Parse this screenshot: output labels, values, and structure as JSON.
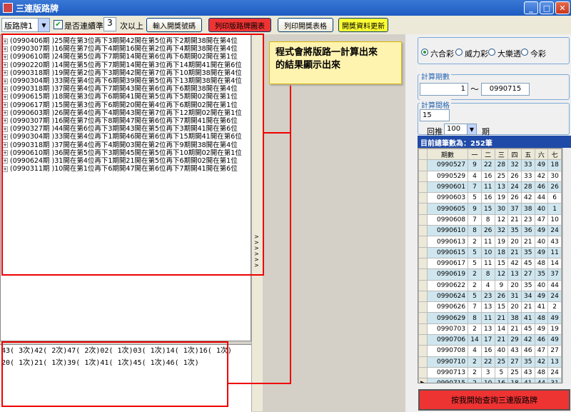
{
  "window": {
    "title": "三連版路牌"
  },
  "toolbar": {
    "combo_value": "版路牌1",
    "checkbox_label": "是否連續準",
    "consecutive_value": "3",
    "consecutive_suffix": "次以上",
    "btn_input": "輸入開獎號碼",
    "btn_print_chart": "列印版路牌圖表",
    "btn_print_table": "列印開獎表格",
    "btn_update": "開獎資料更新"
  },
  "tree": {
    "rows": [
      "(0990406期 )25開在第3位再下3期開42開在第5位再下2期開38開在第4位",
      "(0990307期 )16開在第7位再下4期開16開在第2位再下4期開38開在第4位",
      "(0990610期 )24開在第5位再下7期開14開在第6位再下6期開02開在第1位",
      "(0990220期 )14開在第5位再下7期開14開在第3位再下14期開41開在第6位",
      "(0990318期 )19開在第2位再下3期開42開在第7位再下10期開38開在第4位",
      "(0990304期 )33開在第4位再下6期開39開在第5位再下13期開38開在第4位",
      "(0990318期 )37開在第4位再下7期開43開在第6位再下6期開38開在第4位",
      "(0990615期 )18開在第3位再下6期開41開在第5位再下5期開02開在第1位",
      "(0990617期 )15開在第3位再下6期開20開在第4位再下6期開02開在第1位",
      "(0990603期 )26開在第4位再下4期開43開在第7位再下12期開02開在第1位",
      "(0990307期 )16開在第7位再下8期開47開在第6位再下7期開41開在第6位",
      "(0990327期 )44開在第6位再下3期開43開在第5位再下3期開41開在第6位",
      "(0990304期 )33開在第4位再下1期開46開在第6位再下15期開41開在第6位",
      "(0990318期 )37開在第4位再下4期開03開在第2位再下9期開38開在第4位",
      "(0990610期 )36開在第5位再下3期開45開在第5位再下10期開02開在第1位",
      "(0990624期 )31開在第4位再下1期開21開在第5位再下6期開02開在第1位",
      "(0990311期 )10開在第1位再下6期開47開在第6位再下7期開41開在第6位"
    ]
  },
  "bottom": {
    "line1": "43(   3次)42(   2次)47(   2次)02(   1次)03(   1次)14(   1次)16(   1次)",
    "line2": "20(   1次)21(   1次)39(   1次)41(   1次)45(   1次)46(   1次)"
  },
  "callout": {
    "line1": "程式會將版路一計算出來",
    "line2": "的結果顯示出來"
  },
  "lottery": {
    "options": [
      "六合彩",
      "威力彩",
      "大樂透",
      "今彩"
    ],
    "selected": "六合彩"
  },
  "period": {
    "title": "計算期數",
    "from": "1",
    "sep": "〜",
    "to": "0990715"
  },
  "interval": {
    "title": "計算間格",
    "value": "15",
    "back_label": "回推",
    "back_value": "100",
    "unit": "期"
  },
  "grid": {
    "header": "目前總筆數為：252筆",
    "columns": [
      "期數",
      "一",
      "二",
      "三",
      "四",
      "五",
      "六",
      "七"
    ],
    "rows": [
      [
        "0990527",
        "9",
        "22",
        "28",
        "32",
        "33",
        "49",
        "18"
      ],
      [
        "0990529",
        "4",
        "16",
        "25",
        "26",
        "33",
        "42",
        "30"
      ],
      [
        "0990601",
        "7",
        "11",
        "13",
        "24",
        "28",
        "46",
        "26"
      ],
      [
        "0990603",
        "5",
        "16",
        "19",
        "26",
        "42",
        "44",
        "6"
      ],
      [
        "0990605",
        "9",
        "15",
        "30",
        "37",
        "38",
        "40",
        "1"
      ],
      [
        "0990608",
        "7",
        "8",
        "12",
        "21",
        "23",
        "47",
        "10"
      ],
      [
        "0990610",
        "8",
        "26",
        "32",
        "35",
        "36",
        "49",
        "24"
      ],
      [
        "0990613",
        "2",
        "11",
        "19",
        "20",
        "21",
        "40",
        "43"
      ],
      [
        "0990615",
        "5",
        "10",
        "18",
        "21",
        "35",
        "49",
        "11"
      ],
      [
        "0990617",
        "5",
        "11",
        "15",
        "42",
        "45",
        "48",
        "14"
      ],
      [
        "0990619",
        "2",
        "8",
        "12",
        "13",
        "27",
        "35",
        "37"
      ],
      [
        "0990622",
        "2",
        "4",
        "9",
        "20",
        "35",
        "40",
        "44"
      ],
      [
        "0990624",
        "5",
        "23",
        "26",
        "31",
        "34",
        "49",
        "24"
      ],
      [
        "0990626",
        "7",
        "13",
        "15",
        "20",
        "21",
        "41",
        "2"
      ],
      [
        "0990629",
        "8",
        "11",
        "21",
        "38",
        "41",
        "48",
        "49"
      ],
      [
        "0990703",
        "2",
        "13",
        "14",
        "21",
        "45",
        "49",
        "19"
      ],
      [
        "0990706",
        "14",
        "17",
        "21",
        "29",
        "42",
        "46",
        "49"
      ],
      [
        "0990708",
        "4",
        "16",
        "40",
        "43",
        "46",
        "47",
        "27"
      ],
      [
        "0990710",
        "2",
        "22",
        "25",
        "27",
        "35",
        "42",
        "13"
      ],
      [
        "0990713",
        "2",
        "3",
        "5",
        "25",
        "43",
        "48",
        "24"
      ],
      [
        "0990715",
        "2",
        "10",
        "16",
        "18",
        "41",
        "44",
        "31"
      ]
    ]
  },
  "action": {
    "label": "按我開始查詢三連版路牌"
  }
}
